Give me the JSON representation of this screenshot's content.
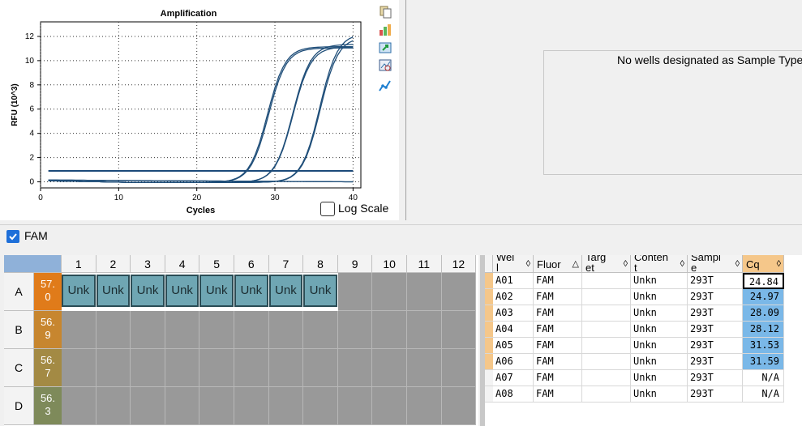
{
  "chart": {
    "toolbar_icons": [
      "copy-icon",
      "export-icon",
      "refresh-icon",
      "zoom-icon",
      "chart-settings-icon"
    ],
    "log_scale_label": "Log Scale",
    "log_scale_checked": false
  },
  "chart_data": {
    "type": "line",
    "title": "Amplification",
    "xlabel": "Cycles",
    "ylabel": "RFU (10^3)",
    "xlim": [
      0,
      41
    ],
    "ylim": [
      -0.5,
      13.2
    ],
    "xticks": [
      0,
      10,
      20,
      30,
      40
    ],
    "yticks": [
      0,
      2,
      4,
      6,
      8,
      10,
      12
    ],
    "threshold": 0.9,
    "series": [
      {
        "well": "A01",
        "cq": 24.84,
        "plateau": 11.2
      },
      {
        "well": "A02",
        "cq": 24.97,
        "plateau": 11.1
      },
      {
        "well": "A03",
        "cq": 28.09,
        "plateau": 11.4
      },
      {
        "well": "A04",
        "cq": 28.12,
        "plateau": 11.2
      },
      {
        "well": "A05",
        "cq": 31.53,
        "plateau": 12.3
      },
      {
        "well": "A06",
        "cq": 31.59,
        "plateau": 12.0
      },
      {
        "well": "A07",
        "cq": null,
        "plateau": 0.0
      },
      {
        "well": "A08",
        "cq": null,
        "plateau": 0.0
      }
    ]
  },
  "sample_panel": {
    "message": "No wells designated as Sample Type"
  },
  "fluor": {
    "label": "FAM",
    "checked": true
  },
  "plate": {
    "columns": [
      "1",
      "2",
      "3",
      "4",
      "5",
      "6",
      "7",
      "8",
      "9",
      "10",
      "11",
      "12"
    ],
    "rows": [
      {
        "label": "A",
        "temp": "57.\n0",
        "temp_color": "#e07b1a",
        "wells": [
          "Unk",
          "Unk",
          "Unk",
          "Unk",
          "Unk",
          "Unk",
          "Unk",
          "Unk",
          "",
          "",
          "",
          ""
        ]
      },
      {
        "label": "B",
        "temp": "56.\n9",
        "temp_color": "#c7862f",
        "wells": [
          "",
          "",
          "",
          "",
          "",
          "",
          "",
          "",
          "",
          "",
          "",
          ""
        ]
      },
      {
        "label": "C",
        "temp": "56.\n7",
        "temp_color": "#a38a44",
        "wells": [
          "",
          "",
          "",
          "",
          "",
          "",
          "",
          "",
          "",
          "",
          "",
          ""
        ]
      },
      {
        "label": "D",
        "temp": "56.\n3",
        "temp_color": "#7e8a5a",
        "wells": [
          "",
          "",
          "",
          "",
          "",
          "",
          "",
          "",
          "",
          "",
          "",
          ""
        ]
      }
    ]
  },
  "table": {
    "headers": [
      {
        "label": "Wel\nl",
        "sort": "◊"
      },
      {
        "label": "Fluor",
        "sort": "△"
      },
      {
        "label": "Targ\net",
        "sort": "◊"
      },
      {
        "label": "Conten\nt",
        "sort": "◊"
      },
      {
        "label": "Sampl\ne",
        "sort": "◊"
      },
      {
        "label": "Cq",
        "sort": "◊"
      }
    ],
    "rows": [
      {
        "well": "A01",
        "fluor": "FAM",
        "target": "",
        "content": "Unkn",
        "sample": "293T",
        "cq": "24.84",
        "selected": true
      },
      {
        "well": "A02",
        "fluor": "FAM",
        "target": "",
        "content": "Unkn",
        "sample": "293T",
        "cq": "24.97",
        "highlight": true
      },
      {
        "well": "A03",
        "fluor": "FAM",
        "target": "",
        "content": "Unkn",
        "sample": "293T",
        "cq": "28.09",
        "highlight": true
      },
      {
        "well": "A04",
        "fluor": "FAM",
        "target": "",
        "content": "Unkn",
        "sample": "293T",
        "cq": "28.12",
        "highlight": true
      },
      {
        "well": "A05",
        "fluor": "FAM",
        "target": "",
        "content": "Unkn",
        "sample": "293T",
        "cq": "31.53",
        "highlight": true
      },
      {
        "well": "A06",
        "fluor": "FAM",
        "target": "",
        "content": "Unkn",
        "sample": "293T",
        "cq": "31.59",
        "highlight": true
      },
      {
        "well": "A07",
        "fluor": "FAM",
        "target": "",
        "content": "Unkn",
        "sample": "293T",
        "cq": "N/A"
      },
      {
        "well": "A08",
        "fluor": "FAM",
        "target": "",
        "content": "Unkn",
        "sample": "293T",
        "cq": "N/A"
      }
    ]
  }
}
